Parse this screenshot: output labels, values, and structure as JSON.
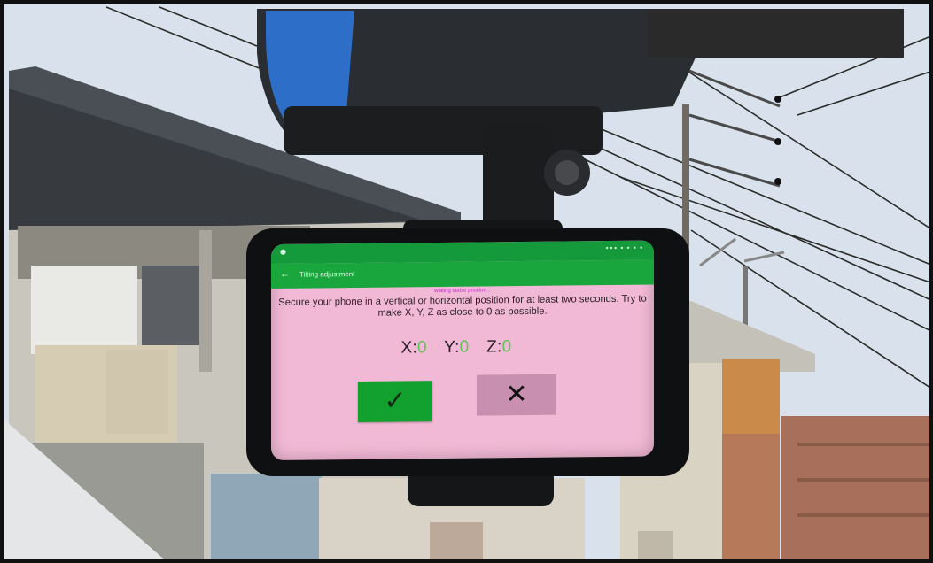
{
  "phone": {
    "status_right": "••• • • • •",
    "app_title": "Tilting adjustment",
    "status_line": "waiting stable position...",
    "instruction": "Secure your phone in a vertical or horizontal position for at least two seconds. Try to make X, Y, Z as close to 0 as possible.",
    "axes": [
      {
        "label": "X:",
        "value": "0"
      },
      {
        "label": "Y:",
        "value": "0"
      },
      {
        "label": "Z:",
        "value": "0"
      }
    ],
    "confirm_icon": "checkmark-icon",
    "cancel_icon": "close-icon",
    "confirm_glyph": "✓",
    "cancel_glyph": "✕",
    "colors": {
      "status_bar": "#149a3a",
      "screen_bg": "#f2b9d6",
      "confirm": "#12a12f",
      "cancel": "#c98fb0",
      "axis_value": "#62c35a"
    }
  }
}
